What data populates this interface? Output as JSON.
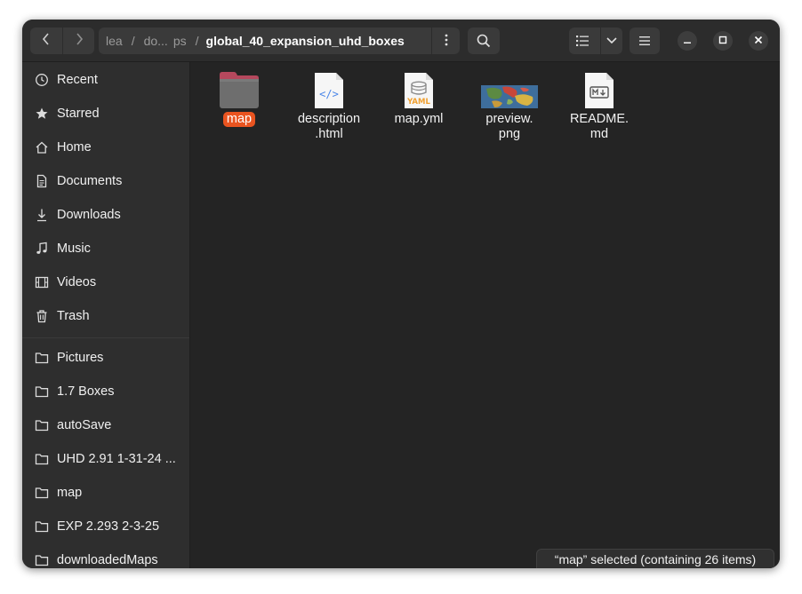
{
  "nav": {
    "back_icon": "chevron-left-icon",
    "forward_icon": "chevron-right-icon"
  },
  "pathbar": {
    "crumbs": [
      "lea",
      "do...",
      "ps"
    ],
    "separator": "/",
    "current": "global_40_expansion_uhd_boxes",
    "menu_icon": "vertical-dots-icon"
  },
  "toolbar": {
    "search_icon": "search-icon",
    "view_icon": "list-view-icon",
    "view_dropdown_icon": "chevron-down-icon",
    "menu_icon": "hamburger-menu-icon"
  },
  "window_controls": {
    "minimize_icon": "minimize-icon",
    "maximize_icon": "maximize-icon",
    "close_icon": "close-icon"
  },
  "sidebar": {
    "places": [
      {
        "label": "Recent",
        "icon": "clock-icon"
      },
      {
        "label": "Starred",
        "icon": "star-icon"
      },
      {
        "label": "Home",
        "icon": "home-icon"
      },
      {
        "label": "Documents",
        "icon": "document-icon"
      },
      {
        "label": "Downloads",
        "icon": "download-icon"
      },
      {
        "label": "Music",
        "icon": "music-icon"
      },
      {
        "label": "Videos",
        "icon": "film-icon"
      },
      {
        "label": "Trash",
        "icon": "trash-icon"
      }
    ],
    "bookmarks": [
      {
        "label": "Pictures",
        "icon": "folder-icon"
      },
      {
        "label": "1.7 Boxes",
        "icon": "folder-icon"
      },
      {
        "label": "autoSave",
        "icon": "folder-icon"
      },
      {
        "label": "UHD 2.91 1-31-24 ...",
        "icon": "folder-icon"
      },
      {
        "label": "map",
        "icon": "folder-icon"
      },
      {
        "label": "EXP 2.293 2-3-25",
        "icon": "folder-icon"
      },
      {
        "label": "downloadedMaps",
        "icon": "folder-icon"
      }
    ]
  },
  "files": [
    {
      "name": "map",
      "name_line2": "",
      "icon": "folder-icon",
      "selected": true
    },
    {
      "name": "description",
      "name_line2": ".html",
      "icon": "html-file-icon",
      "selected": false
    },
    {
      "name": "map.yml",
      "name_line2": "",
      "icon": "yaml-file-icon",
      "selected": false
    },
    {
      "name": "preview.",
      "name_line2": "png",
      "icon": "image-thumbnail-icon",
      "selected": false
    },
    {
      "name": "README.",
      "name_line2": "md",
      "icon": "markdown-file-icon",
      "selected": false
    }
  ],
  "status": {
    "text": "“map” selected  (containing 26 items)"
  },
  "colors": {
    "accent": "#e95420",
    "window_bg": "#242424",
    "sidebar_bg": "#2e2e2e",
    "headerbar_bg": "#2c2c2c",
    "button_bg": "#3a3a3a",
    "folder_tab": "#b5485d",
    "folder_body": "#6e6e6e"
  }
}
